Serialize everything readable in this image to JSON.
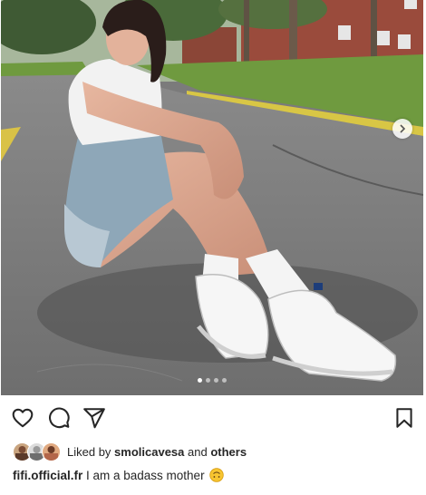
{
  "post": {
    "image_alt_icon": "photo",
    "carousel": {
      "total": 4,
      "active_index": 0
    },
    "actions": {
      "like_icon": "heart-icon",
      "comment_icon": "comment-icon",
      "share_icon": "share-icon",
      "save_icon": "bookmark-icon"
    },
    "likes": {
      "prefix": "Liked by ",
      "user": "smolicavesa",
      "middle": " and ",
      "others": "others"
    },
    "caption": {
      "username": "fifi.official.fr",
      "text": " I am a badass mother",
      "emoji_icon": "upside-down-face-emoji"
    }
  },
  "colors": {
    "text": "#262626",
    "background": "#ffffff"
  }
}
